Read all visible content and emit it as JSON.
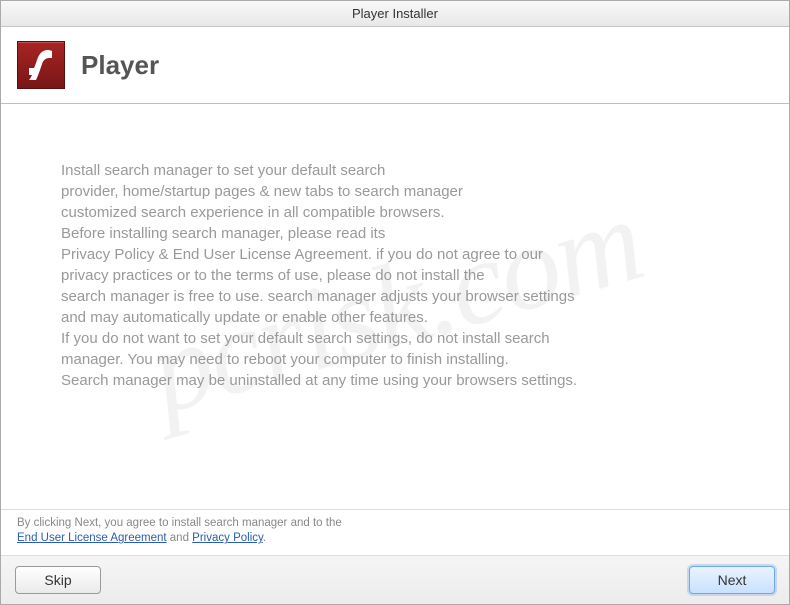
{
  "titlebar": {
    "title": "Player Installer"
  },
  "header": {
    "title": "Player",
    "icon_name": "flash-player-icon"
  },
  "body": {
    "text": "Install search manager to set your default search\nprovider, home/startup pages & new tabs to search manager\ncustomized search experience in all compatible browsers.\nBefore installing search manager, please read its\nPrivacy Policy & End User License Agreement. if you do not agree to our\nprivacy practices or to the terms of use, please do not install the\nsearch manager is free to use. search manager adjusts your browser settings\nand may automatically update or enable other features.\nIf you do not want to set your default search settings, do not install search\nmanager. You may need to reboot your computer to finish installing.\nSearch manager may be uninstalled at any time using your browsers settings."
  },
  "agreement": {
    "prefix": "By clicking Next, you agree to install search manager and to the",
    "eula_link": "End User License Agreement",
    "connector": " and ",
    "privacy_link": "Privacy Policy",
    "suffix": "."
  },
  "footer": {
    "skip_label": "Skip",
    "next_label": "Next"
  },
  "watermark": {
    "text": "pcrisk.com"
  }
}
